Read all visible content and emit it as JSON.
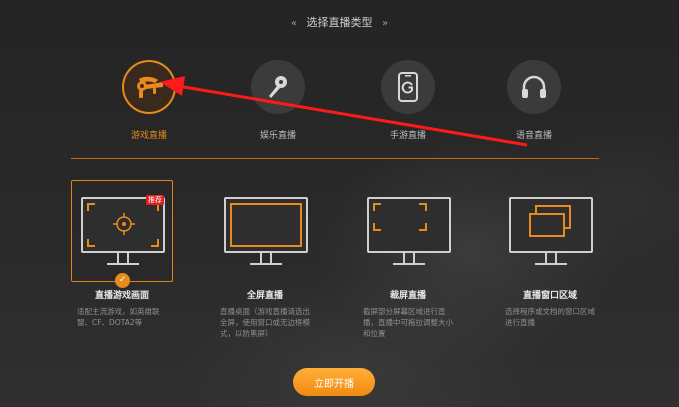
{
  "header": {
    "title": "选择直播类型",
    "left_chev": "«",
    "right_chev": "»"
  },
  "types": [
    {
      "label": "游戏直播",
      "icon": "controller-icon",
      "active": true
    },
    {
      "label": "娱乐直播",
      "icon": "microphone-icon",
      "active": false
    },
    {
      "label": "手游直播",
      "icon": "phone-icon",
      "active": false
    },
    {
      "label": "语音直播",
      "icon": "headphones-icon",
      "active": false
    }
  ],
  "modes": [
    {
      "title": "直播游戏画面",
      "desc": "适配主流游戏，如英雄联盟、CF、DOTA2等",
      "badge": "推荐",
      "active": true
    },
    {
      "title": "全屏直播",
      "desc": "直播桌面（游戏直播请选出全屏，使用窗口或无边框模式，以防黑屏）",
      "active": false
    },
    {
      "title": "裁屏直播",
      "desc": "截屏部分屏幕区域进行直播，直播中可拖拉调整大小和位置",
      "active": false
    },
    {
      "title": "直播窗口区域",
      "desc": "选择程序或文档的窗口区域进行直播",
      "active": false
    }
  ],
  "check_mark": "✓",
  "start_button": "立即开播",
  "colors": {
    "accent": "#e88a1c",
    "badge": "#e02020",
    "divider": "#c06d12",
    "annotation_arrow": "#ff1a1a"
  }
}
